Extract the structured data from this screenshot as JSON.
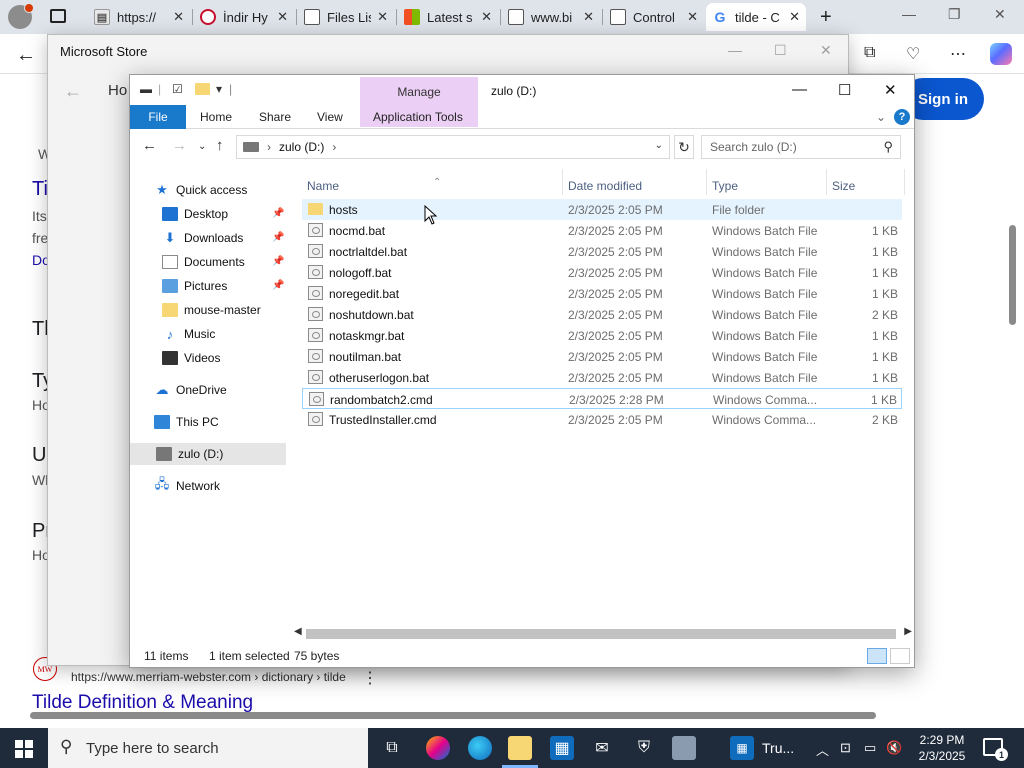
{
  "browser": {
    "tabs": [
      {
        "title": "https://",
        "favicon": "file-icon"
      },
      {
        "title": "İndir Hy",
        "favicon": "opera-icon"
      },
      {
        "title": "Files Lis",
        "favicon": "page-icon"
      },
      {
        "title": "Latest s",
        "favicon": "microsoft-icon"
      },
      {
        "title": "www.bi",
        "favicon": "page-icon"
      },
      {
        "title": "Control",
        "favicon": "page-icon"
      },
      {
        "title": "tilde - C",
        "favicon": "google-icon"
      }
    ],
    "sign_in": "Sign in",
    "page_fragments": {
      "ti": "Ti",
      "its": "Its",
      "fre": "fre",
      "do": "Do",
      "th": "Th",
      "ty": "Ty",
      "ho1": "Ho",
      "us": "Us",
      "wh": "Wh",
      "pr": "Pr",
      "ho2": "Ho",
      "w": "W"
    },
    "result_logo": "MW",
    "result_url": "https://www.merriam-webster.com › dictionary › tilde",
    "result_title": "Tilde Definition & Meaning"
  },
  "store": {
    "title": "Microsoft Store",
    "nav_fragment": "Ho"
  },
  "explorer": {
    "window_title": "zulo (D:)",
    "ribbon_context": "Manage",
    "ribbon_tabs": {
      "file": "File",
      "home": "Home",
      "share": "Share",
      "view": "View",
      "app_tools": "Application Tools"
    },
    "address": {
      "drive": "zulo (D:)",
      "separator": "›"
    },
    "search_placeholder": "Search zulo (D:)",
    "nav_pane": {
      "quick_access": "Quick access",
      "desktop": "Desktop",
      "downloads": "Downloads",
      "documents": "Documents",
      "pictures": "Pictures",
      "mouse_master": "mouse-master",
      "music": "Music",
      "videos": "Videos",
      "onedrive": "OneDrive",
      "this_pc": "This PC",
      "drive": "zulo (D:)",
      "network": "Network"
    },
    "columns": {
      "name": "Name",
      "date": "Date modified",
      "type": "Type",
      "size": "Size"
    },
    "files": [
      {
        "name": "hosts",
        "date": "2/3/2025 2:05 PM",
        "type": "File folder",
        "size": "",
        "icon": "folder-icon"
      },
      {
        "name": "nocmd.bat",
        "date": "2/3/2025 2:05 PM",
        "type": "Windows Batch File",
        "size": "1 KB",
        "icon": "batch-file-icon"
      },
      {
        "name": "noctrlaltdel.bat",
        "date": "2/3/2025 2:05 PM",
        "type": "Windows Batch File",
        "size": "1 KB",
        "icon": "batch-file-icon"
      },
      {
        "name": "nologoff.bat",
        "date": "2/3/2025 2:05 PM",
        "type": "Windows Batch File",
        "size": "1 KB",
        "icon": "batch-file-icon"
      },
      {
        "name": "noregedit.bat",
        "date": "2/3/2025 2:05 PM",
        "type": "Windows Batch File",
        "size": "1 KB",
        "icon": "batch-file-icon"
      },
      {
        "name": "noshutdown.bat",
        "date": "2/3/2025 2:05 PM",
        "type": "Windows Batch File",
        "size": "2 KB",
        "icon": "batch-file-icon"
      },
      {
        "name": "notaskmgr.bat",
        "date": "2/3/2025 2:05 PM",
        "type": "Windows Batch File",
        "size": "1 KB",
        "icon": "batch-file-icon"
      },
      {
        "name": "noutilman.bat",
        "date": "2/3/2025 2:05 PM",
        "type": "Windows Batch File",
        "size": "1 KB",
        "icon": "batch-file-icon"
      },
      {
        "name": "otheruserlogon.bat",
        "date": "2/3/2025 2:05 PM",
        "type": "Windows Batch File",
        "size": "1 KB",
        "icon": "batch-file-icon"
      },
      {
        "name": "randombatch2.cmd",
        "date": "2/3/2025 2:28 PM",
        "type": "Windows Comma...",
        "size": "1 KB",
        "icon": "cmd-file-icon"
      },
      {
        "name": "TrustedInstaller.cmd",
        "date": "2/3/2025 2:05 PM",
        "type": "Windows Comma...",
        "size": "2 KB",
        "icon": "cmd-file-icon"
      }
    ],
    "status": {
      "items": "11 items",
      "selected": "1 item selected",
      "bytes": "75 bytes"
    }
  },
  "taskbar": {
    "search_placeholder": "Type here to search",
    "pinned_label": "Tru...",
    "time": "2:29 PM",
    "date": "2/3/2025",
    "notification_count": "1"
  }
}
